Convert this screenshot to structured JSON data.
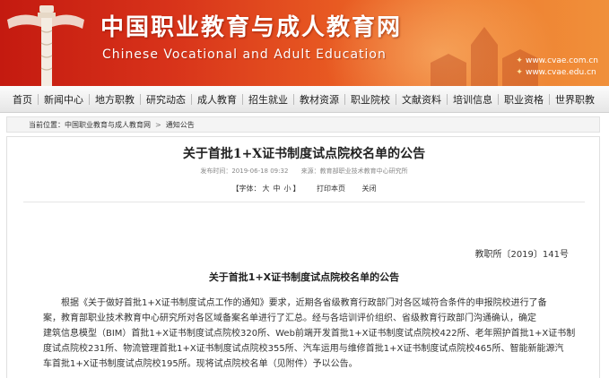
{
  "banner": {
    "title_cn": "中国职业教育与成人教育网",
    "title_en": "Chinese Vocational and Adult Education",
    "urls": [
      "www.cvae.com.cn",
      "www.cvae.edu.cn"
    ]
  },
  "nav": {
    "items": [
      "首页",
      "新闻中心",
      "地方职教",
      "研究动态",
      "成人教育",
      "招生就业",
      "教材资源",
      "职业院校",
      "文献资料",
      "培训信息",
      "职业资格",
      "世界职教"
    ]
  },
  "breadcrumb": {
    "label": "当前位置：",
    "site": "中国职业教育与成人教育网",
    "separator": ">",
    "current": "通知公告"
  },
  "article": {
    "title": "关于首批1+X证书制度试点院校名单的公告",
    "publish_time": "发布时间：2019-06-18 09:32",
    "source": "来源：教育部职业技术教育中心研究所",
    "font_label": "【字体：",
    "font_sizes": [
      "大",
      "中",
      "小"
    ],
    "font_close": "】",
    "print_label": "打印本页",
    "close_label": "关闭",
    "doc_number": "教职所〔2019〕141号",
    "doc_title": "关于首批1+X证书制度试点院校名单的公告",
    "body_lines": [
      "　　根据《关于做好首批1+X证书制度试点工作的通知》要求，近期各省级教育行政部门对各区域符合条件的申报院校进行了备",
      "案，教育部职业技术教育中心研究所对各区域备案名单进行了汇总。经与各培训评价组织、省级教育行政部门沟通确认，确定",
      "建筑信息模型（BIM）首批1+X证书制度试点院校320所、Web前端开发首批1+X证书制度试点院校422所、老年照护首批1+X证书制",
      "度试点院校231所、物流管理首批1+X证书制度试点院校355所、汽车运用与维修首批1+X证书制度试点院校465所、智能新能源汽",
      "车首批1+X证书制度试点院校195所。现将试点院校名单（见附件）予以公告。"
    ]
  }
}
